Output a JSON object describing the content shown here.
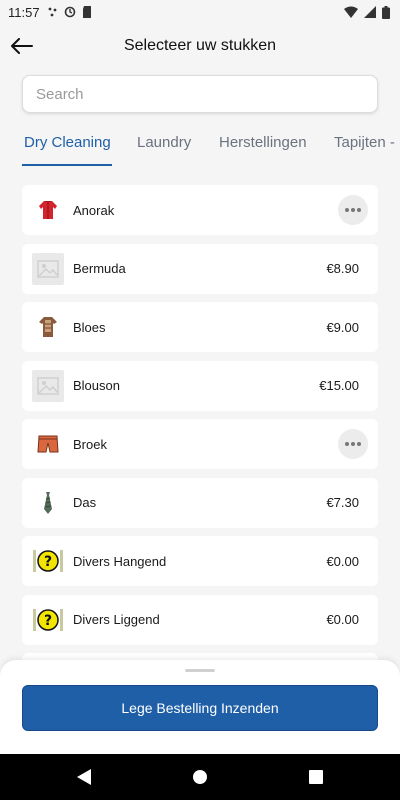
{
  "status_bar": {
    "time": "11:57",
    "icons": [
      "bluetooth-icon",
      "sync-icon",
      "sd-card-icon",
      "wifi-icon",
      "signal-icon",
      "battery-icon"
    ]
  },
  "header": {
    "title": "Selecteer uw stukken",
    "back_icon": "arrow-left-icon"
  },
  "search": {
    "placeholder": "Search",
    "value": ""
  },
  "tabs": [
    {
      "label": "Dry Cleaning",
      "active": true
    },
    {
      "label": "Laundry",
      "active": false
    },
    {
      "label": "Herstellingen",
      "active": false
    },
    {
      "label": "Tapijten - (",
      "active": false
    }
  ],
  "items": [
    {
      "name": "Anorak",
      "price": "",
      "icon": "red-jacket-icon",
      "has_options": true
    },
    {
      "name": "Bermuda",
      "price": "€8.90",
      "icon": "image-placeholder-icon",
      "has_options": false
    },
    {
      "name": "Bloes",
      "price": "€9.00",
      "icon": "blouse-icon",
      "has_options": false
    },
    {
      "name": "Blouson",
      "price": "€15.00",
      "icon": "image-placeholder-icon",
      "has_options": false
    },
    {
      "name": "Broek",
      "price": "",
      "icon": "shorts-icon",
      "has_options": true
    },
    {
      "name": "Das",
      "price": "€7.30",
      "icon": "tie-icon",
      "has_options": false
    },
    {
      "name": "Divers Hangend",
      "price": "€0.00",
      "icon": "question-mark-icon",
      "has_options": false
    },
    {
      "name": "Divers Liggend",
      "price": "€0.00",
      "icon": "question-mark-icon",
      "has_options": false
    }
  ],
  "bottom": {
    "submit_label": "Lege Bestelling Inzenden"
  },
  "colors": {
    "accent": "#1f5fa8",
    "background": "#f5f5f5",
    "card": "#ffffff"
  }
}
